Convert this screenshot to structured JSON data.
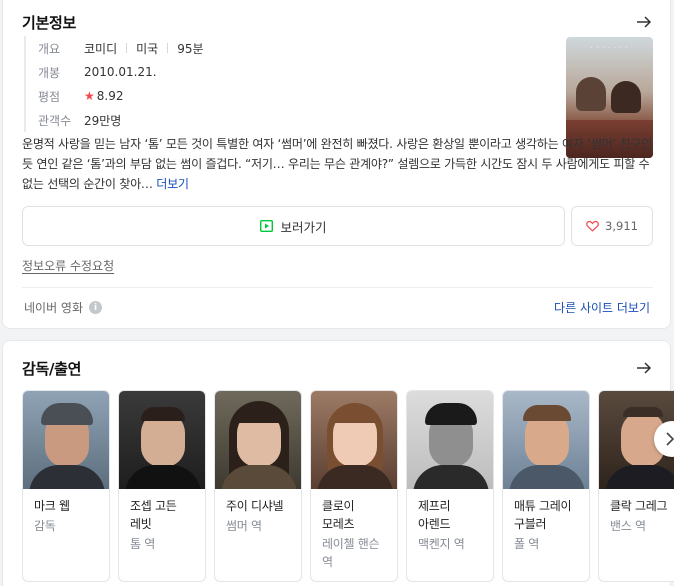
{
  "basic_info": {
    "title": "기본정보",
    "rows": {
      "overview_label": "개요",
      "genre": "코미디",
      "country": "미국",
      "runtime": "95분",
      "release_label": "개봉",
      "release_date": "2010.01.21.",
      "rating_label": "평점",
      "rating": "8.92",
      "audience_label": "관객수",
      "audience": "29만명"
    },
    "synopsis": "운명적 사랑을 믿는 남자 ‘톰’ 모든 것이 특별한 여자 ‘썸머’에 완전히 빠졌다. 사랑은 환상일 뿐이라고 생각하는 여자 ‘썸머’ 친구인 듯 연인 같은 ‘톰’과의 부담 없는 썸이 즐겁다. “저기… 우리는 무슨 관계야?” 설렘으로 가득한 시간도 잠시 두 사람에게도 피할 수 없는 선택의 순간이 찾아…",
    "more_label": "더보기",
    "watch_label": "보러가기",
    "like_count": "3,911",
    "report_label": "정보오류 수정요청",
    "source_label": "네이버 영화",
    "other_sites_label": "다른 사이트 더보기"
  },
  "cast": {
    "title": "감독/출연",
    "members": [
      {
        "name": "마크 웹",
        "role": "감독"
      },
      {
        "name": "조셉 고든 레빗",
        "role": "톰 역"
      },
      {
        "name": "주이 디샤넬",
        "role": "썸머 역"
      },
      {
        "name": "클로이 모레츠",
        "role": "레이첼 핸슨 역"
      },
      {
        "name": "제프리 아렌드",
        "role": "맥켄지 역"
      },
      {
        "name": "매튜 그레이 구블러",
        "role": "폴 역"
      },
      {
        "name": "클락 그레그",
        "role": "밴스 역"
      }
    ]
  },
  "colors": {
    "accent_blue": "#1a4fb4",
    "star_red": "#f5474d",
    "play_green": "#00c73c"
  }
}
